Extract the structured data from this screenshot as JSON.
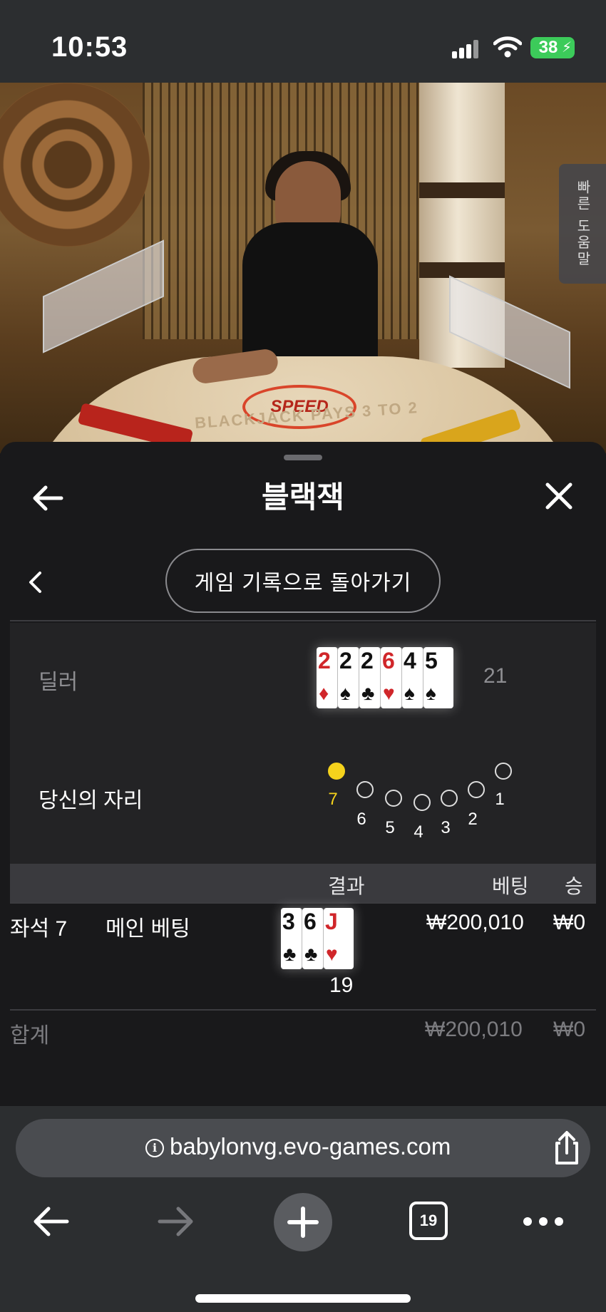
{
  "status_bar": {
    "time": "10:53",
    "battery": "38",
    "icons": [
      "signal-icon",
      "wifi-icon",
      "battery-icon"
    ]
  },
  "video": {
    "table_logo": "SPEED",
    "table_text": "BLACKJACK PAYS 3 TO 2"
  },
  "help_tab": {
    "label": "빠른 도움말"
  },
  "sheet": {
    "title": "블랙잭",
    "back_icon": "arrow-left-icon",
    "close_icon": "close-icon",
    "history_button": "게임 기록으로 돌아가기"
  },
  "summary": {
    "dealer_label": "딜러",
    "dealer_score": "21",
    "dealer_cards": [
      {
        "rank": "2",
        "suit": "♦",
        "color": "red"
      },
      {
        "rank": "2",
        "suit": "♠",
        "color": "black"
      },
      {
        "rank": "2",
        "suit": "♣",
        "color": "black"
      },
      {
        "rank": "6",
        "suit": "♥",
        "color": "red"
      },
      {
        "rank": "4",
        "suit": "♠",
        "color": "black"
      },
      {
        "rank": "5",
        "suit": "♠",
        "color": "black"
      }
    ],
    "seat_label": "당신의 자리",
    "seats": [
      {
        "num": "7",
        "active": true
      },
      {
        "num": "6",
        "active": false
      },
      {
        "num": "5",
        "active": false
      },
      {
        "num": "4",
        "active": false
      },
      {
        "num": "3",
        "active": false
      },
      {
        "num": "2",
        "active": false
      },
      {
        "num": "1",
        "active": false
      }
    ],
    "active_color": "#f5d21c"
  },
  "results_table": {
    "headers": {
      "result": "결과",
      "bet": "베팅",
      "win": "승"
    },
    "rows": [
      {
        "seat": "좌석 7",
        "bet_type": "메인 베팅",
        "cards": [
          {
            "rank": "3",
            "suit": "♣",
            "color": "black"
          },
          {
            "rank": "6",
            "suit": "♣",
            "color": "black"
          },
          {
            "rank": "J",
            "suit": "♥",
            "color": "red"
          }
        ],
        "score": "19",
        "bet": "₩200,010",
        "win": "₩0"
      }
    ],
    "total": {
      "label": "합계",
      "bet": "₩200,010",
      "win": "₩0"
    }
  },
  "browser": {
    "url": "babylonvg.evo-games.com",
    "tab_count": "19",
    "icons": [
      "info-icon",
      "share-icon",
      "back-icon",
      "forward-icon",
      "plus-icon",
      "tabs-icon",
      "more-icon"
    ]
  }
}
